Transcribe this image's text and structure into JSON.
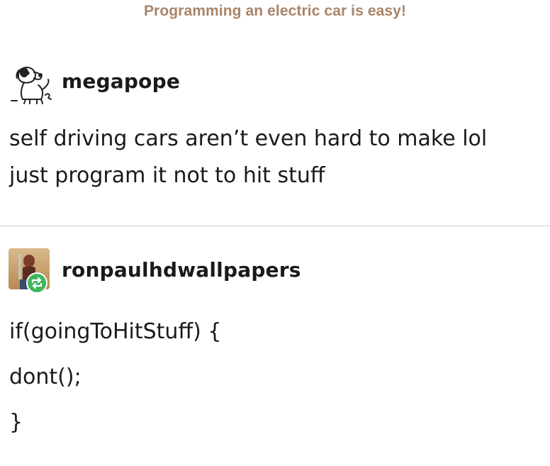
{
  "caption": "Programming an electric car is easy!",
  "posts": [
    {
      "username": "megapope",
      "avatar": "dog-sketch-icon",
      "lines": [
        "self driving cars aren’t even hard to make lol",
        "just program it not to hit stuff"
      ]
    },
    {
      "username": "ronpaulhdwallpapers",
      "avatar": "ron-paul-photo-icon",
      "badge": "reblog-icon",
      "lines": [
        "if(goingToHitStuff) {",
        "dont();",
        "}"
      ]
    }
  ],
  "colors": {
    "caption": "#a88468",
    "reblog_badge": "#3fb75b",
    "divider": "#cfcfcf"
  }
}
